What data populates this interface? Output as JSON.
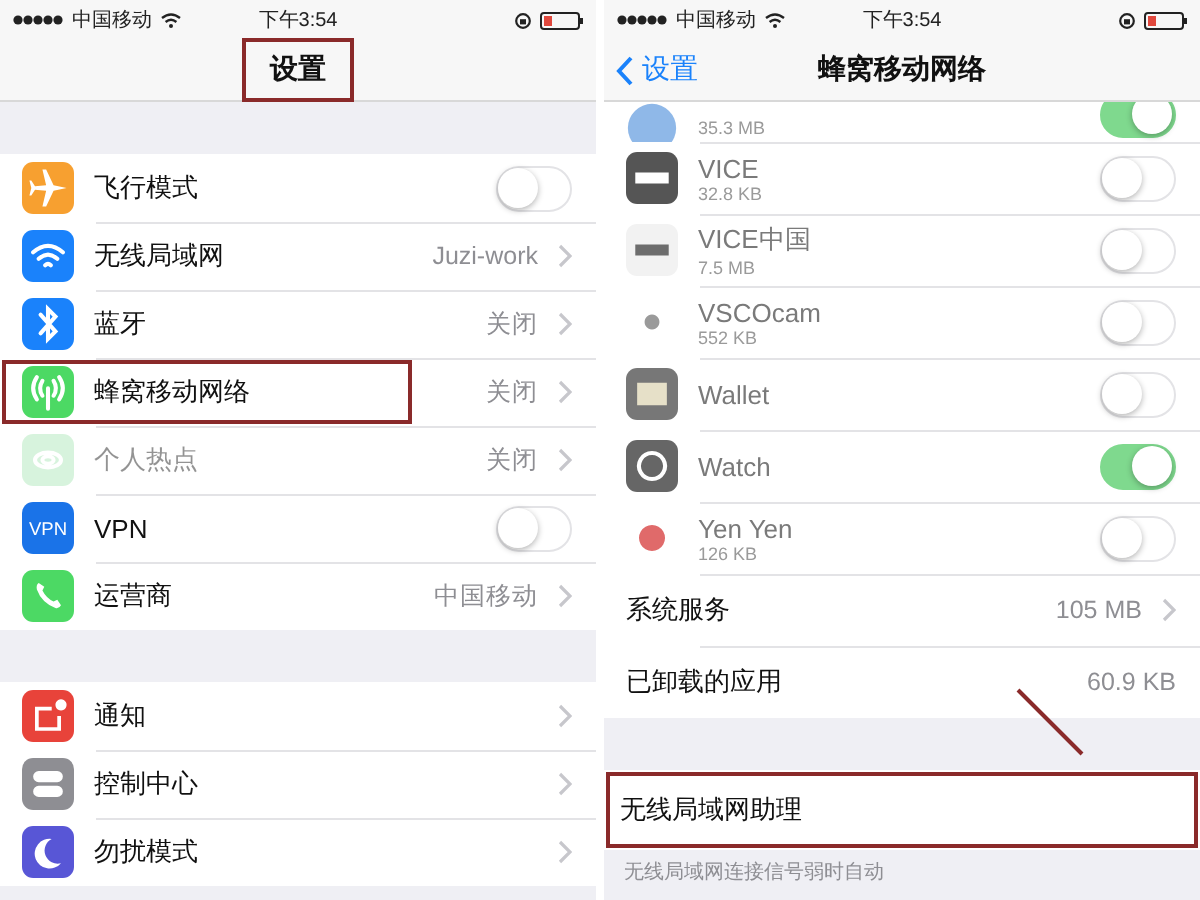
{
  "screens": [
    {
      "status_bar": {
        "carrier": "中国移动",
        "time": "下午3:54"
      },
      "nav": {
        "title": "设置",
        "annotated": true
      },
      "groups": [
        [
          {
            "kind": "switch",
            "label": "飞行模式",
            "on": false
          },
          {
            "kind": "link",
            "label": "无线局域网",
            "value": "Juzi-work"
          },
          {
            "kind": "link",
            "label": "蓝牙",
            "value": "关闭"
          },
          {
            "kind": "link",
            "label": "蜂窝移动网络",
            "value": "关闭",
            "annotated": true
          },
          {
            "kind": "link",
            "label": "个人热点",
            "value": "关闭",
            "disabled": true
          },
          {
            "kind": "switch",
            "label": "VPN",
            "on": false,
            "badge": "VPN"
          },
          {
            "kind": "link",
            "label": "运营商",
            "value": "中国移动"
          }
        ],
        [
          {
            "kind": "link",
            "label": "通知"
          },
          {
            "kind": "link",
            "label": "控制中心"
          },
          {
            "kind": "link",
            "label": "勿扰模式"
          }
        ]
      ]
    },
    {
      "status_bar": {
        "carrier": "中国移动",
        "time": "下午3:54"
      },
      "nav": {
        "back": "设置",
        "title": "蜂窝移动网络",
        "annotated": false
      },
      "groups": [
        [
          {
            "kind": "app",
            "sub": "35.3 MB",
            "on": true
          },
          {
            "kind": "app",
            "label": "VICE",
            "sub": "32.8 KB",
            "on": false
          },
          {
            "kind": "app",
            "label": "VICE中国",
            "sub": "7.5 MB",
            "on": false
          },
          {
            "kind": "app",
            "label": "VSCOcam",
            "sub": "552 KB",
            "on": false
          },
          {
            "kind": "app",
            "label": "Wallet",
            "on": false
          },
          {
            "kind": "app",
            "label": "Watch",
            "on": true
          },
          {
            "kind": "app",
            "label": "Yen Yen",
            "sub": "126 KB",
            "on": false
          },
          {
            "kind": "link",
            "label": "系统服务",
            "value": "105 MB"
          },
          {
            "kind": "value",
            "label": "已卸载的应用",
            "value": "60.9 KB"
          }
        ],
        [
          {
            "kind": "plain",
            "label": "无线局域网助理",
            "annotated": true
          }
        ]
      ],
      "footer": "无线局域网连接信号弱时自动"
    }
  ]
}
